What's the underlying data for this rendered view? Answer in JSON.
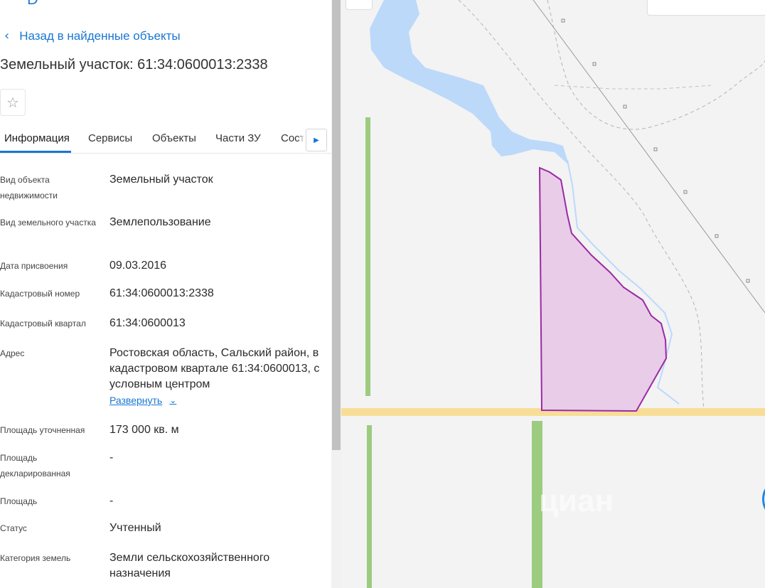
{
  "header": {
    "back_label": "Назад в найденные объекты",
    "title": "Земельный участок: 61:34:0600013:2338"
  },
  "icons": {
    "back": "chevron-left-icon",
    "favorite": "star-icon",
    "tab_next": "caret-right-icon",
    "expand": "chevron-down-icon"
  },
  "tabs": [
    {
      "label": "Информация",
      "active": true
    },
    {
      "label": "Сервисы"
    },
    {
      "label": "Объекты"
    },
    {
      "label": "Части ЗУ"
    },
    {
      "label": "Состав"
    }
  ],
  "fields": [
    {
      "label": "Вид объекта недвижимости",
      "value": "Земельный участок"
    },
    {
      "label": "Вид земельного участка",
      "value": "Землепользование"
    },
    {
      "label": "Дата присвоения",
      "value": "09.03.2016"
    },
    {
      "label": "Кадастровый номер",
      "value": "61:34:0600013:2338"
    },
    {
      "label": "Кадастровый квартал",
      "value": "61:34:0600013"
    },
    {
      "label": "Адрес",
      "value": "Ростовская область, Сальский район, в кадастровом квартале 61:34:0600013, с условным центром"
    },
    {
      "label": "Площадь уточненная",
      "value": "173 000 кв. м"
    },
    {
      "label": "Площадь декларированная",
      "value": "-"
    },
    {
      "label": "Площадь",
      "value": "-"
    },
    {
      "label": "Статус",
      "value": "Учтенный"
    },
    {
      "label": "Категория земель",
      "value": "Земли сельскохозяйственного назначения"
    }
  ],
  "expand_label": "Развернуть",
  "map": {
    "watermark": "циан",
    "colors": {
      "water": "#bcd9fa",
      "parcel_fill": "#e8cce8",
      "parcel_stroke": "#9b2aa5",
      "road": "#f7dd97",
      "field_strip": "#9ccc7f"
    }
  }
}
